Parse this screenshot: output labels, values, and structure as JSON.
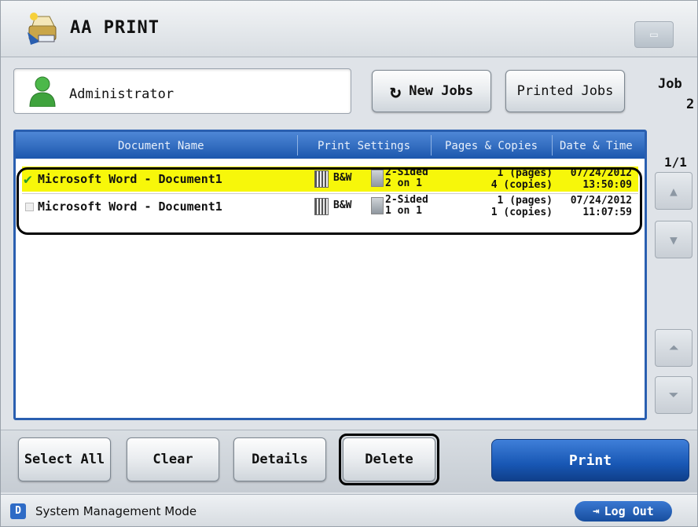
{
  "app": {
    "title": "AA PRINT"
  },
  "user": {
    "name": "Administrator"
  },
  "toolbar": {
    "new_jobs_label": "New Jobs",
    "printed_jobs_label": "Printed Jobs"
  },
  "job_counter": {
    "label": "Job",
    "count": "2"
  },
  "table": {
    "headers": [
      "Document Name",
      "Print Settings",
      "Pages & Copies",
      "Date & Time"
    ],
    "rows": [
      {
        "selected": true,
        "name": "Microsoft Word - Document1",
        "color": "B&W",
        "sides": "2-Sided",
        "layout": "2 on 1",
        "pages": "1 (pages)",
        "copies": "4 (copies)",
        "date": "07/24/2012",
        "time": "13:50:09"
      },
      {
        "selected": false,
        "name": "Microsoft Word - Document1",
        "color": "B&W",
        "sides": "2-Sided",
        "layout": "1 on 1",
        "pages": "1 (pages)",
        "copies": "1 (copies)",
        "date": "07/24/2012",
        "time": "11:07:59"
      }
    ]
  },
  "pager": {
    "text": "1/1"
  },
  "actions": {
    "select_all": "Select All",
    "clear": "Clear",
    "details": "Details",
    "delete": "Delete",
    "print": "Print"
  },
  "status": {
    "mode_icon_letter": "D",
    "mode_label": "System Management Mode",
    "logout_label": "Log Out"
  },
  "colors": {
    "header_blue": "#1c57ad",
    "selected_row": "#f7f70a",
    "print_blue": "#1857b4"
  }
}
